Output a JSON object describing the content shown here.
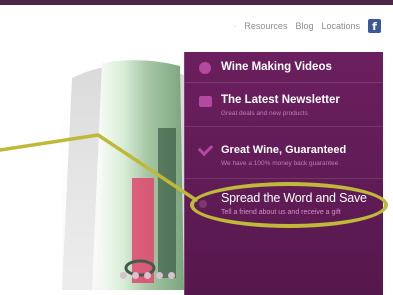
{
  "nav": {
    "items": [
      {
        "label": "Resources"
      },
      {
        "label": "Blog"
      },
      {
        "label": "Locations"
      }
    ],
    "facebook_glyph": "f"
  },
  "panel": {
    "items": [
      {
        "title": "Wine Making Videos",
        "subtitle": "",
        "icon": "play-circle-icon"
      },
      {
        "title": "The Latest Newsletter",
        "subtitle": "Great deals and new products",
        "icon": "newsletter-icon"
      },
      {
        "title": "Great Wine, Guaranteed",
        "subtitle": "We have a 100% money back guarantee",
        "icon": "checkmark-icon"
      },
      {
        "title": "Spread the Word and Save",
        "subtitle": "Tell a friend about us and receive a gift",
        "icon": "share-icon"
      }
    ]
  },
  "slider": {
    "dot_count": 5
  },
  "colors": {
    "panel_bg": "#6b1f5e",
    "highlight": "#c0b838",
    "accent_icon": "#b34a9f",
    "facebook": "#3b5998"
  }
}
